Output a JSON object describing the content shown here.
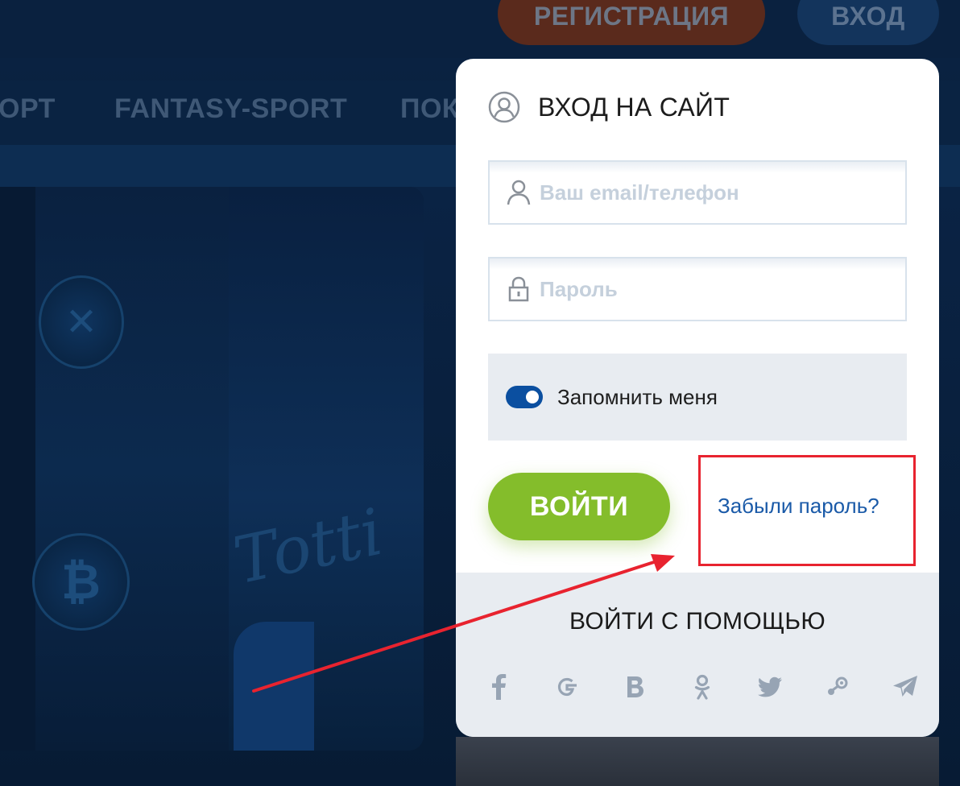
{
  "header": {
    "register_label": "РЕГИСТРАЦИЯ",
    "login_label": "ВХОД"
  },
  "nav": {
    "items": [
      "ОРТ",
      "FANTASY-SPORT",
      "ПОК"
    ]
  },
  "banner": {
    "script_text": "Totti"
  },
  "login": {
    "title": "ВХОД НА САЙТ",
    "email_placeholder": "Ваш email/телефон",
    "password_placeholder": "Пароль",
    "remember_label": "Запомнить меня",
    "remember_checked": true,
    "submit_label": "ВОЙТИ",
    "forgot_label": "Забыли пароль?",
    "social_title": "ВОЙТИ С ПОМОЩЬЮ",
    "social_icons": [
      "facebook-icon",
      "google-icon",
      "vk-icon",
      "odnoklassniki-icon",
      "twitter-icon",
      "steam-icon",
      "telegram-icon"
    ]
  },
  "colors": {
    "accent_green": "#84bd2b",
    "link_blue": "#1a5aa8",
    "toggle_blue": "#0b4fa0",
    "annotation_red": "#e8232f",
    "background_navy": "#081d38"
  }
}
